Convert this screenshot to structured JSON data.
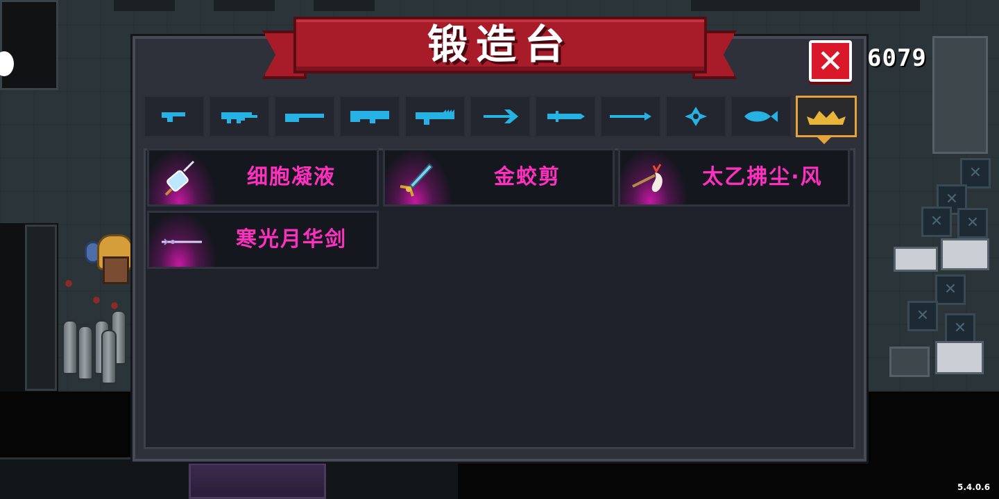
{
  "title": "锻造台",
  "gems": "6079",
  "version": "5.4.0.6",
  "close_label": "✕",
  "colors": {
    "banner": "#a81c2a",
    "close": "#d9182a",
    "tab_icon": "#27b2e6",
    "active_tab_border": "#e8a23a",
    "weapon_name": "#ff2fc0"
  },
  "tabs": [
    {
      "icon": "pistol-icon"
    },
    {
      "icon": "rifle-icon"
    },
    {
      "icon": "shotgun-icon"
    },
    {
      "icon": "launcher-icon"
    },
    {
      "icon": "laser-gun-icon"
    },
    {
      "icon": "bow-icon"
    },
    {
      "icon": "sword-icon"
    },
    {
      "icon": "spear-icon"
    },
    {
      "icon": "shuriken-icon"
    },
    {
      "icon": "fish-icon"
    },
    {
      "icon": "crown-icon",
      "active": true
    }
  ],
  "weapons": [
    {
      "name": "细胞凝液",
      "icon": "syringe-icon"
    },
    {
      "name": "金蛟剪",
      "icon": "scissors-blade-icon"
    },
    {
      "name": "太乙拂尘·风",
      "icon": "whisk-icon"
    },
    {
      "name": "寒光月华剑",
      "icon": "moon-sword-icon"
    }
  ]
}
